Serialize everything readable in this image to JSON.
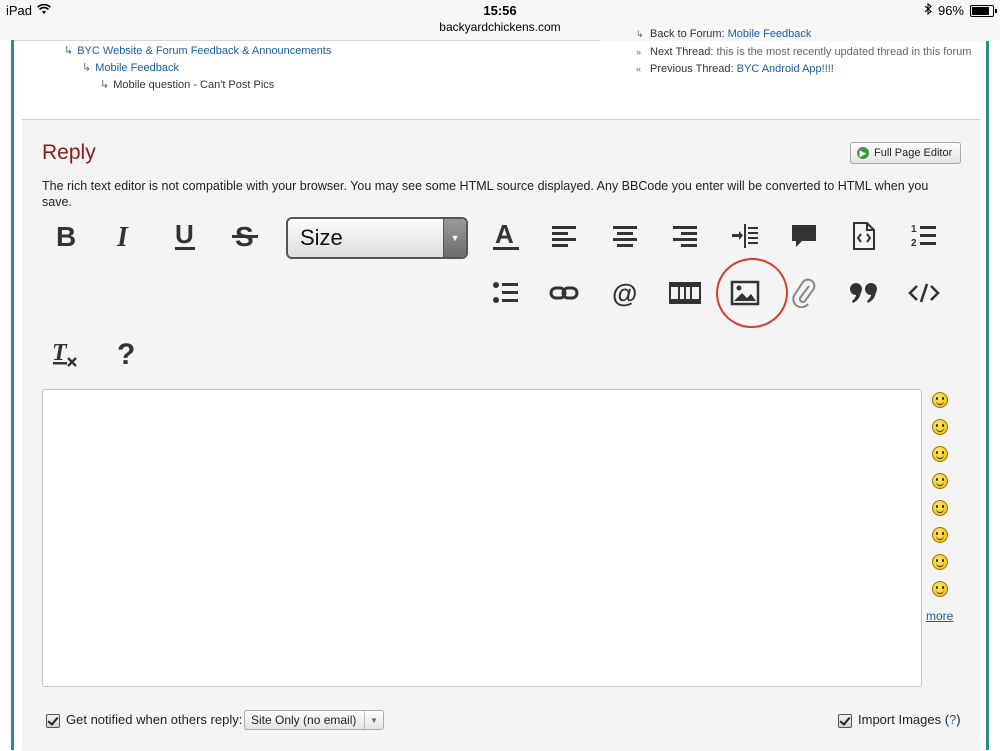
{
  "status_bar": {
    "device": "iPad",
    "time": "15:56",
    "url": "backyardchickens.com",
    "battery": "96%",
    "battery_level": 0.96
  },
  "breadcrumb": {
    "level1": "BYC Website & Forum Feedback & Announcements",
    "level2": "Mobile Feedback",
    "level3": "Mobile question - Can't Post Pics"
  },
  "thread_nav": {
    "back_label": "Back to Forum:",
    "back_link": "Mobile Feedback",
    "next_label": "Next Thread:",
    "next_text": "this is the most recently updated thread in this forum",
    "prev_label": "Previous Thread:",
    "prev_link": "BYC Android App!!!!"
  },
  "reply": {
    "title": "Reply",
    "full_page_editor": "Full Page Editor",
    "notice": "The rich text editor is not compatible with your browser. You may see some HTML source displayed. Any BBCode you enter will be converted to HTML when you save.",
    "size_select_value": "Size",
    "toolbar_icons": [
      "bold-icon",
      "italic-icon",
      "underline-icon",
      "strikethrough-icon",
      "font-size-select",
      "text-color-icon",
      "align-left-icon",
      "align-center-icon",
      "align-right-icon",
      "indent-icon",
      "comment-icon",
      "source-icon",
      "numbered-list-icon",
      "bullet-list-icon",
      "link-icon",
      "mention-icon",
      "video-icon",
      "image-icon",
      "attach-icon",
      "quote-icon",
      "code-icon",
      "clear-format-icon",
      "help-icon"
    ]
  },
  "smileys": {
    "items": [
      "smile",
      "frown",
      "big-grin",
      "wink",
      "neutral",
      "tongue",
      "cool",
      "confused"
    ],
    "more": "more"
  },
  "footer": {
    "notify_label": "Get notified when others reply:",
    "notify_value": "Site Only (no email)",
    "notify_checked": true,
    "import_label": "Import Images (",
    "import_help": "?",
    "import_close": ")",
    "import_checked": true
  },
  "colors": {
    "title": "#8b1a1a",
    "link": "#1a5fa0",
    "panel": "#f4f4f4",
    "annotation_circle": "#d83a2c"
  }
}
